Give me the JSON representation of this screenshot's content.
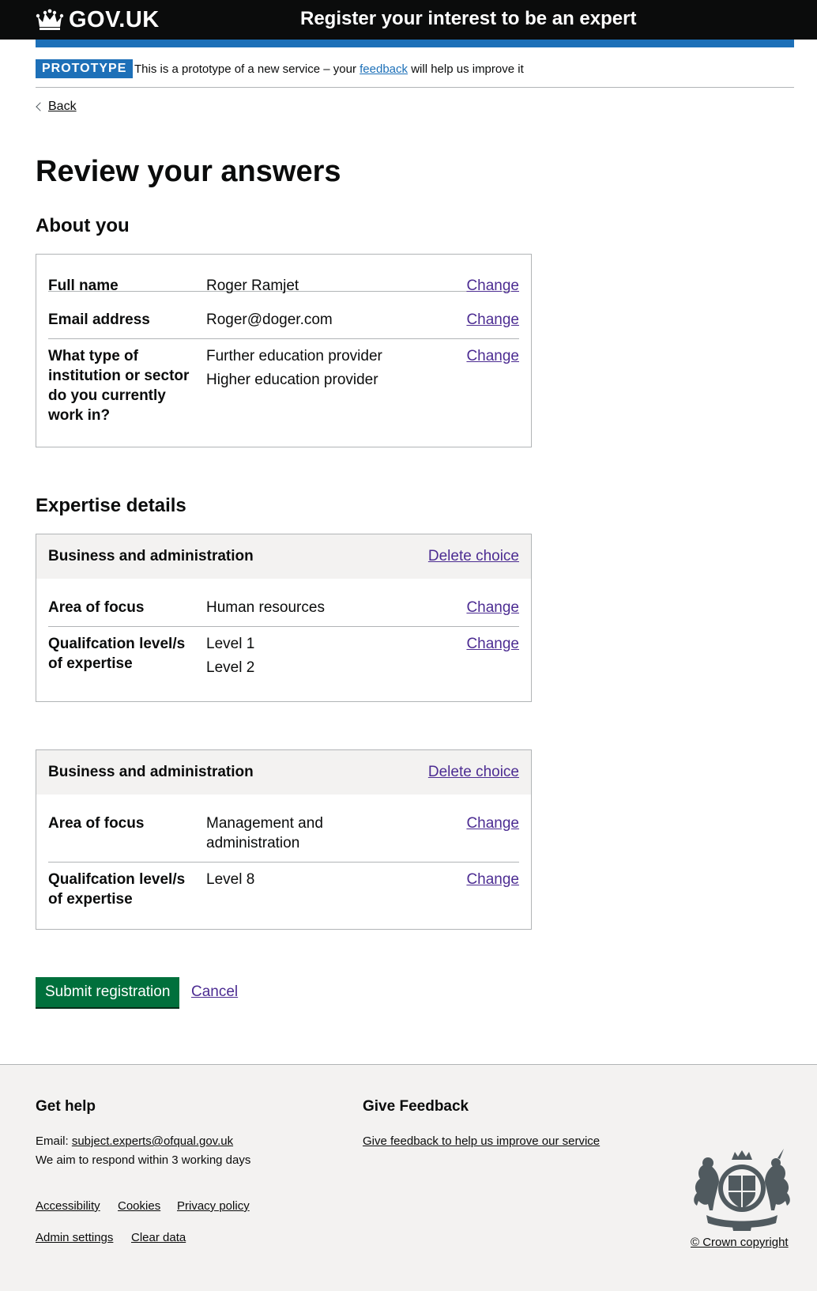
{
  "header": {
    "logo_text": "GOV.UK",
    "service_name": "Register your interest to be an expert",
    "logo_icon": "crown-icon"
  },
  "phase_banner": {
    "tag": "PROTOTYPE",
    "text_before": "This is a prototype of a new service – your ",
    "link_text": "feedback",
    "text_after": " will help us improve it"
  },
  "back_link": "Back",
  "page_title": "Review your answers",
  "about_you": {
    "heading": "About you",
    "rows": [
      {
        "key": "Full name",
        "values": [
          "Roger Ramjet"
        ],
        "action": "Change"
      },
      {
        "key": "Email address",
        "values": [
          "Roger@doger.com"
        ],
        "action": "Change"
      },
      {
        "key": "What type of institution or sector do you currently work in?",
        "values": [
          "Further education provider",
          "Higher education provider"
        ],
        "action": "Change"
      }
    ]
  },
  "expertise": {
    "heading": "Expertise details",
    "cards": [
      {
        "title": "Business and administration",
        "action": "Delete choice",
        "rows": [
          {
            "key": "Area of focus",
            "values": [
              "Human resources"
            ],
            "action": "Change"
          },
          {
            "key": "Qualifcation level/s of expertise",
            "values": [
              "Level 1",
              "Level 2"
            ],
            "action": "Change"
          }
        ]
      },
      {
        "title": "Business and administration",
        "action": "Delete choice",
        "rows": [
          {
            "key": "Area of focus",
            "values": [
              "Management and administration"
            ],
            "action": "Change"
          },
          {
            "key": "Qualifcation level/s of expertise",
            "values": [
              "Level 8"
            ],
            "action": "Change"
          }
        ]
      }
    ]
  },
  "actions": {
    "submit": "Submit registration",
    "cancel": "Cancel"
  },
  "footer": {
    "help_heading": "Get help",
    "email_label": "Email: ",
    "email": "subject.experts@ofqual.gov.uk",
    "respond_text": "We aim to respond within 3 working days",
    "feedback_heading": "Give Feedback",
    "feedback_link": "Give feedback to help us improve our service",
    "links": [
      "Accessibility",
      "Cookies",
      "Privacy policy"
    ],
    "links2": [
      "Admin settings",
      "Clear data"
    ],
    "copyright": "© Crown copyright",
    "crest_icon": "royal-coat-of-arms-icon"
  },
  "colors": {
    "header_bg": "#0b0c0c",
    "brand_blue": "#1d70b8",
    "link": "#4c2c92",
    "button_green": "#00703c",
    "footer_bg": "#f3f2f1"
  }
}
